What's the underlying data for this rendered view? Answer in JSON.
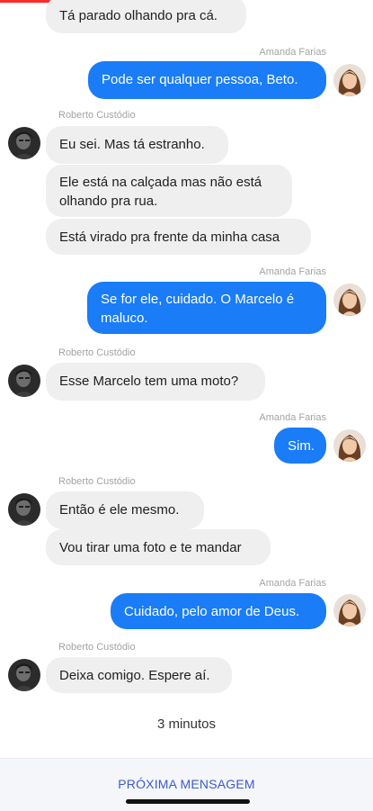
{
  "chat": {
    "participants": {
      "amanda": "Amanda Farias",
      "roberto": "Roberto Custódio"
    },
    "messages": [
      {
        "text": "Tá parado olhando pra cá."
      },
      {
        "text": "Pode ser qualquer pessoa, Beto."
      },
      {
        "text": "Eu sei. Mas tá estranho."
      },
      {
        "text": "Ele está na calçada mas não está olhando pra rua."
      },
      {
        "text": "Está virado pra frente da minha casa"
      },
      {
        "text": "Se for ele, cuidado. O Marcelo é maluco."
      },
      {
        "text": "Esse Marcelo tem uma moto?"
      },
      {
        "text": "Sim."
      },
      {
        "text": "Então é ele mesmo."
      },
      {
        "text": "Vou tirar uma foto e te mandar"
      },
      {
        "text": "Cuidado, pelo amor de Deus."
      },
      {
        "text": "Deixa comigo. Espere aí."
      }
    ],
    "timestamp": "3 minutos"
  },
  "footer": {
    "next_label": "PRÓXIMA MENSAGEM"
  },
  "colors": {
    "outgoing_bubble": "#1a7cf7",
    "incoming_bubble": "#efefef",
    "next_button": "#3b5bcc",
    "progress": "#ff2a2a"
  },
  "icons": {
    "amanda_avatar": "woman-portrait-avatar",
    "roberto_avatar": "man-dark-avatar"
  }
}
